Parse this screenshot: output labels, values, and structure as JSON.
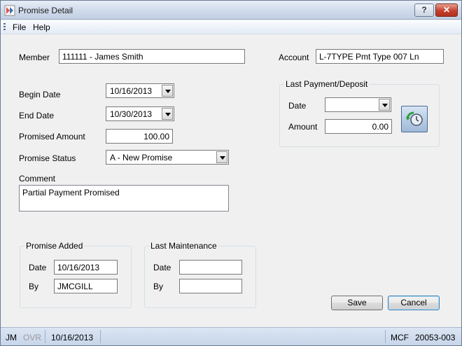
{
  "window": {
    "title": "Promise Detail",
    "help_label": "?",
    "close_label": "✕"
  },
  "menu": {
    "items": [
      "File",
      "Help"
    ]
  },
  "member": {
    "label": "Member",
    "value": "111111 - James Smith"
  },
  "account": {
    "label": "Account",
    "value": "L-7TYPE Pmt Type 007 Ln"
  },
  "begin_date": {
    "label": "Begin Date",
    "value": "10/16/2013"
  },
  "end_date": {
    "label": "End Date",
    "value": "10/30/2013"
  },
  "promised_amount": {
    "label": "Promised Amount",
    "value": "100.00"
  },
  "promise_status": {
    "label": "Promise Status",
    "value": "A - New Promise"
  },
  "comment": {
    "label": "Comment",
    "value": "Partial Payment Promised"
  },
  "last_payment": {
    "title": "Last Payment/Deposit",
    "date_label": "Date",
    "date_value": "",
    "amount_label": "Amount",
    "amount_value": "0.00",
    "refresh_icon": "refresh-clock-icon"
  },
  "promise_added": {
    "title": "Promise Added",
    "date_label": "Date",
    "date_value": "10/16/2013",
    "by_label": "By",
    "by_value": "JMCGILL"
  },
  "last_maintenance": {
    "title": "Last Maintenance",
    "date_label": "Date",
    "date_value": "",
    "by_label": "By",
    "by_value": ""
  },
  "buttons": {
    "save": "Save",
    "cancel": "Cancel"
  },
  "status": {
    "user": "JM",
    "ovr": "OVR",
    "date": "10/16/2013",
    "system": "MCF",
    "code": "20053-003"
  },
  "colors": {
    "window_bg": "#f0f0f0",
    "title_bar": "#cfdaea",
    "status_bar": "#c8d6ea",
    "close_red": "#c4402d"
  }
}
